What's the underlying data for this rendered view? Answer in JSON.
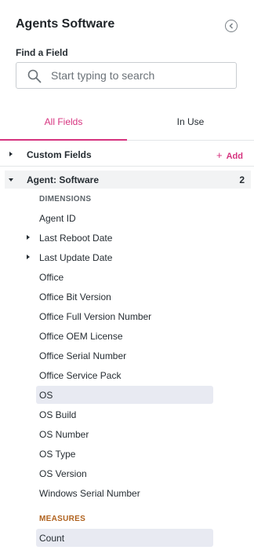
{
  "header": {
    "title": "Agents Software",
    "collapse_icon": "chevron-left-circle-icon"
  },
  "search": {
    "label": "Find a Field",
    "placeholder": "Start typing to search",
    "value": ""
  },
  "tabs": [
    {
      "label": "All Fields",
      "active": true
    },
    {
      "label": "In Use",
      "active": false
    }
  ],
  "custom_fields": {
    "label": "Custom Fields",
    "add_label": "Add"
  },
  "group": {
    "label": "Agent: Software",
    "count": "2"
  },
  "dimensions": {
    "heading": "DIMENSIONS",
    "items": [
      {
        "label": "Agent ID"
      },
      {
        "label": "Last Reboot Date",
        "expandable": true
      },
      {
        "label": "Last Update Date",
        "expandable": true
      },
      {
        "label": "Office"
      },
      {
        "label": "Office Bit Version"
      },
      {
        "label": "Office Full Version Number"
      },
      {
        "label": "Office OEM License"
      },
      {
        "label": "Office Serial Number"
      },
      {
        "label": "Office Service Pack"
      },
      {
        "label": "OS",
        "selected": true
      },
      {
        "label": "OS Build"
      },
      {
        "label": "OS Number"
      },
      {
        "label": "OS Type"
      },
      {
        "label": "OS Version"
      },
      {
        "label": "Windows Serial Number"
      }
    ]
  },
  "measures": {
    "heading": "MEASURES",
    "items": [
      {
        "label": "Count",
        "selected": true
      }
    ]
  },
  "colors": {
    "accent": "#d6337f",
    "selected_bg": "#e8eaf2",
    "measure_heading": "#b0621e"
  }
}
